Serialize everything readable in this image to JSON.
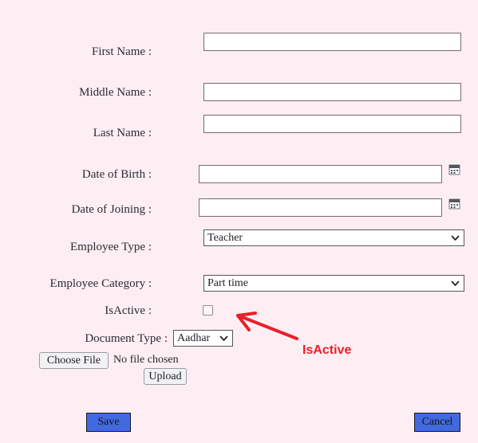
{
  "form": {
    "fields": [
      {
        "label": "First Name :",
        "value": "",
        "type": "text"
      },
      {
        "label": "Middle Name :",
        "value": "",
        "type": "text"
      },
      {
        "label": "Last Name :",
        "value": "",
        "type": "text"
      },
      {
        "label": "Date of Birth :",
        "value": "",
        "type": "date",
        "icon": "calendar-icon"
      },
      {
        "label": "Date of Joining :",
        "value": "",
        "type": "date",
        "icon": "calendar-icon"
      },
      {
        "label": "Employee Type :",
        "value": "Teacher",
        "type": "select",
        "icon": "chevron-down-icon"
      },
      {
        "label": "Employee Category :",
        "value": "Part time",
        "type": "select",
        "icon": "chevron-down-icon"
      },
      {
        "label": "IsActive :",
        "value": "",
        "type": "checkbox",
        "checked": false
      }
    ],
    "document": {
      "label": "Document Type :",
      "value": "Aadhar",
      "icon": "chevron-down-icon"
    },
    "file": {
      "choose_label": "Choose File",
      "status": "No file chosen",
      "upload_label": "Upload"
    },
    "actions": {
      "save_label": "Save",
      "cancel_label": "Cancel"
    }
  },
  "annotation": {
    "text": "IsActive",
    "color": "#e8202a",
    "arrow": "arrow-up-left"
  },
  "colors": {
    "page_background": "#fdeef3",
    "input_background": "#ffffff",
    "button_primary": "#4169e1",
    "annotation_red": "#e8202a"
  }
}
